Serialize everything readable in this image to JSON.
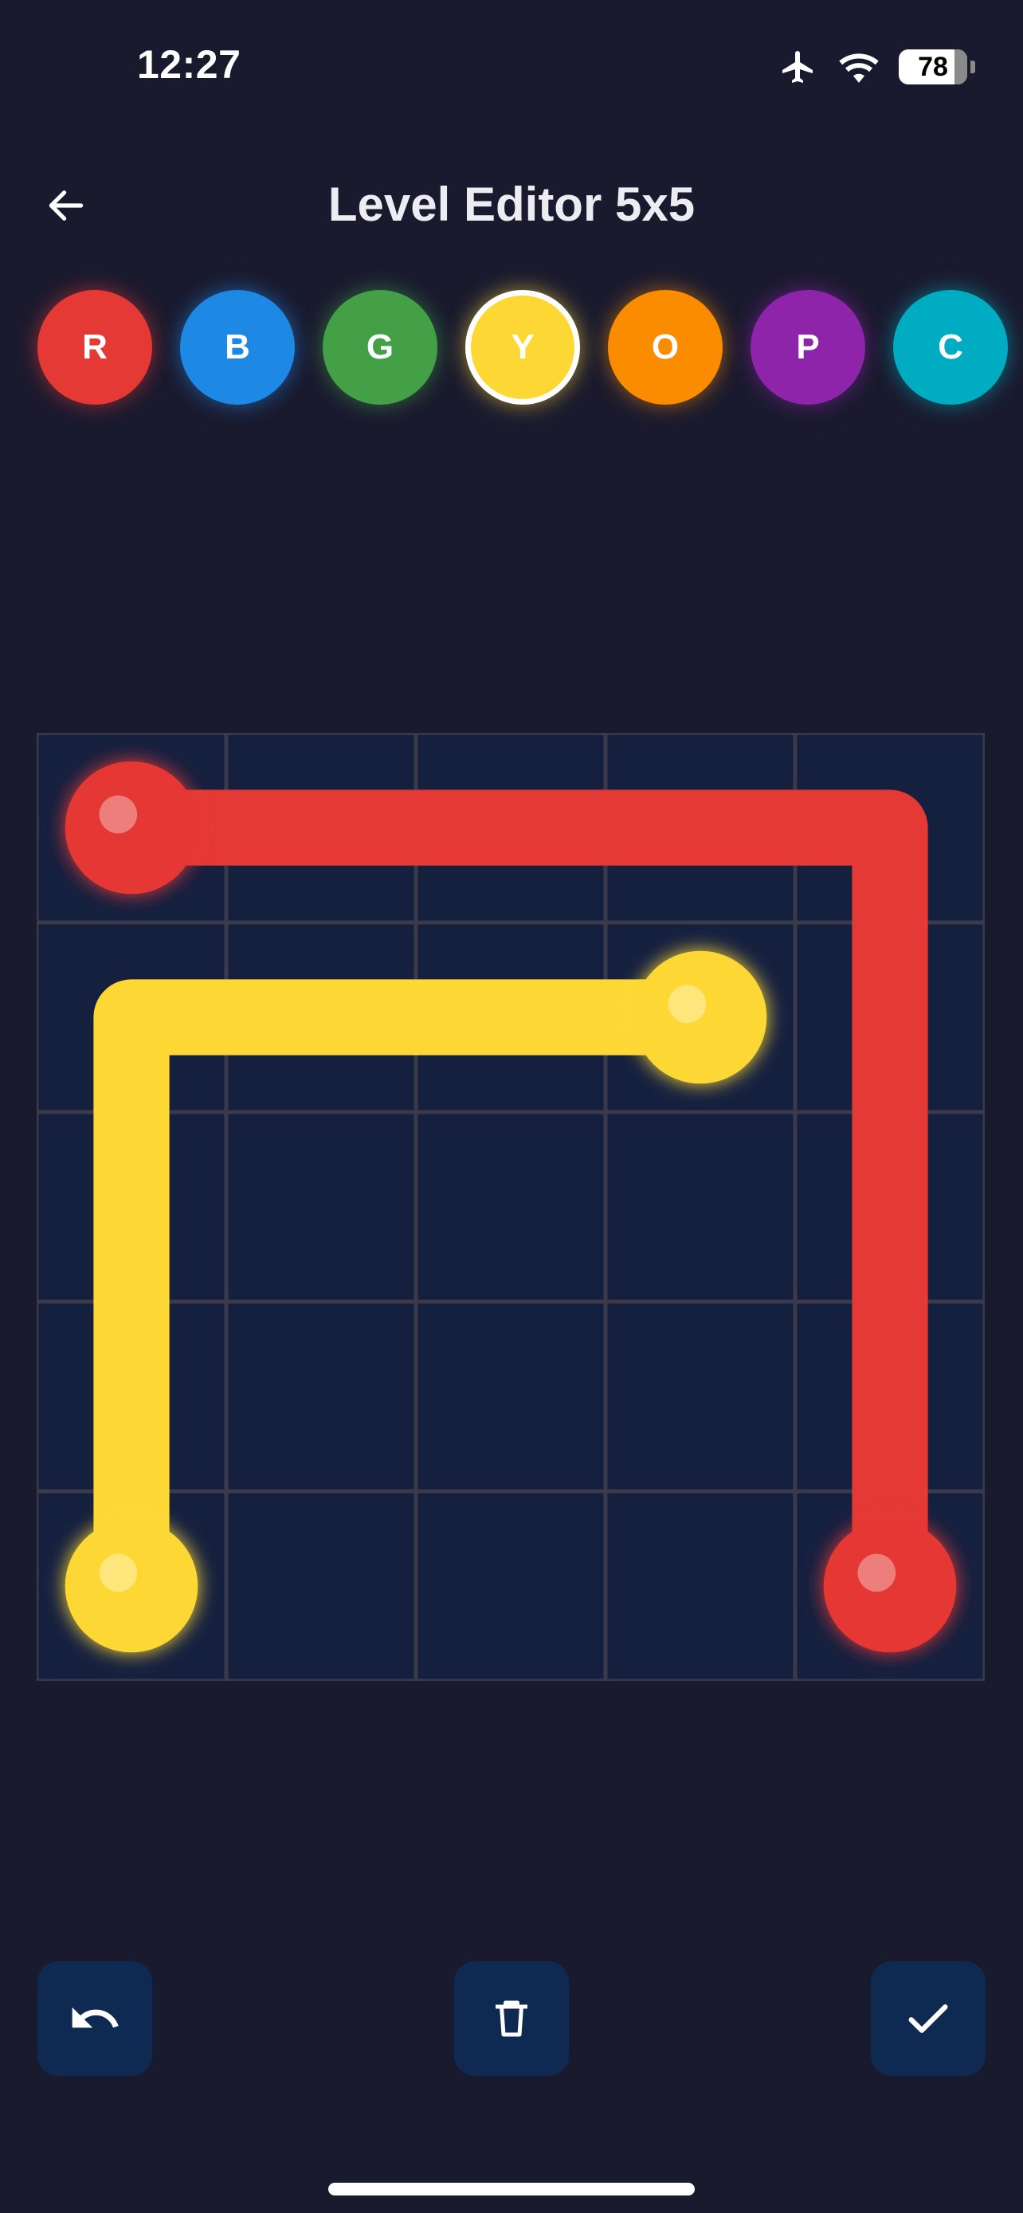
{
  "status_bar": {
    "time": "12:27",
    "battery_level": "78",
    "icons": [
      "airplane-icon",
      "wifi-icon",
      "battery-icon"
    ]
  },
  "header": {
    "title": "Level Editor 5x5",
    "back_icon": "arrow-left-icon"
  },
  "palette": {
    "selected": "Y",
    "colors": [
      {
        "label": "R",
        "color": "#e53935"
      },
      {
        "label": "B",
        "color": "#1e88e5"
      },
      {
        "label": "G",
        "color": "#43a047"
      },
      {
        "label": "Y",
        "color": "#fdd835"
      },
      {
        "label": "O",
        "color": "#fb8c00"
      },
      {
        "label": "P",
        "color": "#8e24aa"
      },
      {
        "label": "C",
        "color": "#00acc1"
      }
    ]
  },
  "board": {
    "rows": 5,
    "cols": 5,
    "cell_color": "#15203f",
    "grid_line_color": "#3a3a4a",
    "paths": [
      {
        "color": "R",
        "hex": "#e53935",
        "cells": [
          [
            0,
            0
          ],
          [
            0,
            1
          ],
          [
            0,
            2
          ],
          [
            0,
            3
          ],
          [
            0,
            4
          ],
          [
            1,
            4
          ],
          [
            2,
            4
          ],
          [
            3,
            4
          ],
          [
            4,
            4
          ]
        ],
        "endpoints": [
          [
            0,
            0
          ],
          [
            4,
            4
          ]
        ]
      },
      {
        "color": "Y",
        "hex": "#fdd835",
        "cells": [
          [
            1,
            3
          ],
          [
            1,
            2
          ],
          [
            1,
            1
          ],
          [
            1,
            0
          ],
          [
            2,
            0
          ],
          [
            3,
            0
          ],
          [
            4,
            0
          ]
        ],
        "endpoints": [
          [
            1,
            3
          ],
          [
            4,
            0
          ]
        ]
      }
    ]
  },
  "actions": {
    "undo_icon": "undo-icon",
    "delete_icon": "trash-icon",
    "confirm_icon": "checkmark-icon",
    "button_color": "#0f2a52"
  }
}
